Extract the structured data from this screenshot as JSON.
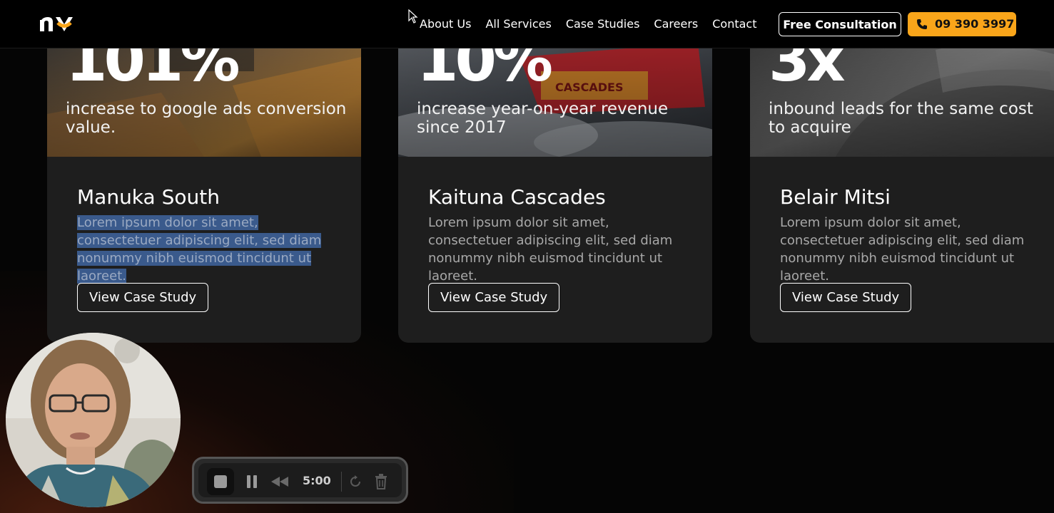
{
  "header": {
    "logo_text": "ny",
    "nav": [
      "About Us",
      "All Services",
      "Case Studies",
      "Careers",
      "Contact"
    ],
    "cta_label": "Free Consultation",
    "phone_label": "09 390 3997",
    "colors": {
      "accent": "#f9a51a",
      "background": "#000000"
    }
  },
  "cards": [
    {
      "stat": "101%",
      "stat_desc": "increase to google ads conversion value.",
      "title": "Manuka South",
      "body": "Lorem ipsum dolor sit amet, consectetuer adipiscing elit, sed diam nonummy nibh euismod tincidunt ut laoreet.",
      "button": "View Case Study"
    },
    {
      "stat": "10%",
      "stat_desc": "increase year-on-year revenue since 2017",
      "title": "Kaituna Cascades",
      "body": "Lorem ipsum dolor sit amet, consectetuer adipiscing elit, sed diam nonummy nibh euismod tincidunt ut laoreet.",
      "button": "View Case Study"
    },
    {
      "stat": "3x",
      "stat_desc": "inbound leads for the same cost to acquire",
      "title": "Belair Mitsi",
      "body": "Lorem ipsum dolor sit amet, consectetuer adipiscing elit, sed diam nonummy nibh euismod tincidunt ut laoreet.",
      "button": "View Case Study"
    }
  ],
  "recorder": {
    "time": "5:00",
    "icons": [
      "stop-icon",
      "pause-icon",
      "rewind-icon",
      "restart-icon",
      "trash-icon"
    ]
  }
}
